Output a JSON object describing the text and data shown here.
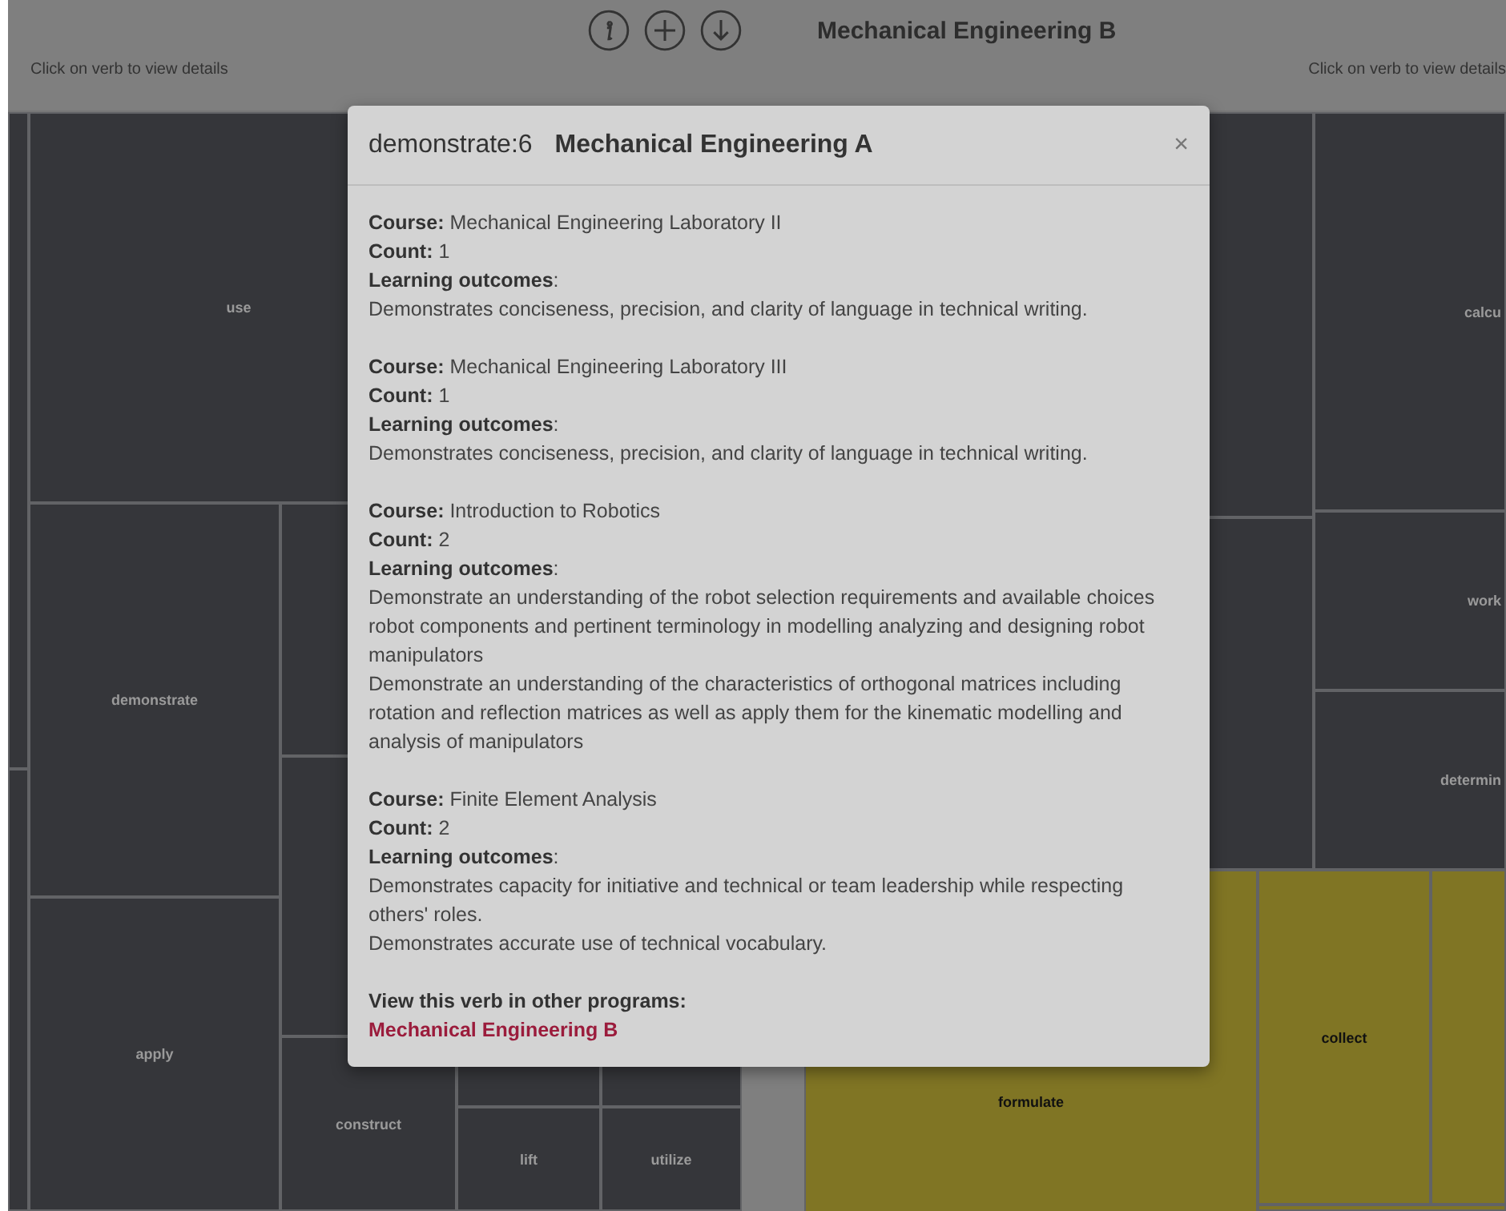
{
  "header": {
    "icons": [
      {
        "kind": "info"
      },
      {
        "kind": "add"
      },
      {
        "kind": "download"
      }
    ],
    "title": "Mechanical Engineering B",
    "hint_left": "Click on verb to view details",
    "hint_right": "Click on verb to view details"
  },
  "treemap_a": {
    "cells": [
      {
        "color": "#35363a"
      },
      {
        "color": "#35363a"
      },
      {
        "label": "use",
        "color": "#35363a"
      },
      {
        "label": "demonstrate",
        "color": "#35363a"
      },
      {
        "color": "#35363a"
      },
      {
        "color": "#35363a"
      },
      {
        "label": "apply",
        "color": "#35363a"
      },
      {
        "label": "construct",
        "color": "#35363a"
      },
      {
        "color": "#35363a"
      },
      {
        "color": "#35363a"
      },
      {
        "label": "lift",
        "color": "#35363a"
      },
      {
        "label": "utilize",
        "color": "#35363a"
      }
    ]
  },
  "treemap_b": {
    "cells": [
      {
        "color": "#35363a"
      },
      {
        "color": "#35363a"
      },
      {
        "label": "calcu",
        "color": "#35363a"
      },
      {
        "label": "work",
        "color": "#35363a"
      },
      {
        "label": "determin",
        "color": "#35363a"
      },
      {
        "label": "formulate",
        "color": "#807524"
      },
      {
        "label": "collect",
        "color": "#807524"
      },
      {
        "color": "#807524"
      },
      {
        "color": "#807524"
      }
    ]
  },
  "modal": {
    "verb": "demonstrate:6",
    "program": "Mechanical Engineering A",
    "close": "×",
    "courses": [
      {
        "course": "**Course:** Mechanical Engineering Laboratory II",
        "count": "**Count:** 1",
        "outcomes_heading": "**Learning outcomes**:",
        "outcomes": [
          "Demonstrates conciseness, precision, and clarity of language in technical writing."
        ]
      },
      {
        "course": "**Course:** Mechanical Engineering Laboratory III",
        "count": "**Count:** 1",
        "outcomes_heading": "**Learning outcomes**:",
        "outcomes": [
          "Demonstrates conciseness, precision, and clarity of language in technical writing."
        ]
      },
      {
        "course": "**Course:** Introduction to Robotics",
        "count": "**Count:** 2",
        "outcomes_heading": "**Learning outcomes**:",
        "outcomes": [
          "Demonstrate an understanding of the robot selection requirements and available choices robot components and pertinent terminology in modelling analyzing and designing robot manipulators",
          "Demonstrate an understanding of the characteristics of orthogonal matrices including rotation and reflection matrices as well as apply them for the kinematic modelling and analysis of manipulators"
        ]
      },
      {
        "course": "**Course:** Finite Element Analysis",
        "count": "**Count:** 2",
        "outcomes_heading": "**Learning outcomes**:",
        "outcomes": [
          "Demonstrates capacity for initiative and technical or team leadership while respecting others' roles.",
          "Demonstrates accurate use of technical vocabulary."
        ]
      }
    ],
    "other_heading": "View this verb in other programs:",
    "other_links": [
      "Mechanical Engineering B"
    ]
  }
}
